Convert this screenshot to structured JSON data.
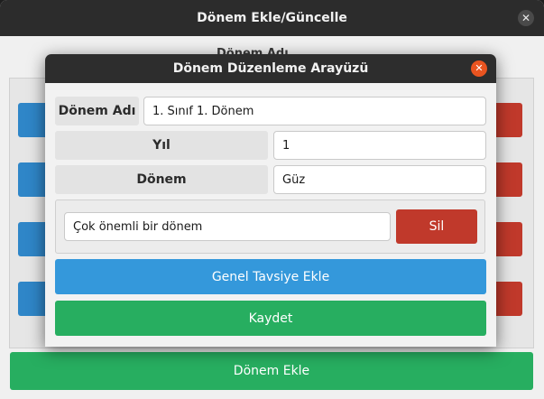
{
  "outer_window": {
    "title": "Dönem Ekle/Güncelle",
    "partial_heading": "Dönem Adı",
    "close_glyph": "✕",
    "add_term_label": "Dönem Ekle"
  },
  "dialog": {
    "title": "Dönem Düzenleme Arayüzü",
    "close_glyph": "✕",
    "fields": {
      "term_name_label": "Dönem Adı",
      "term_name_value": "1. Sınıf 1. Dönem",
      "year_label": "Yıl",
      "year_value": "1",
      "semester_label": "Dönem",
      "semester_value": "Güz"
    },
    "note": {
      "value": "Çok önemli bir dönem",
      "delete_label": "Sil"
    },
    "add_general_advice_label": "Genel Tavsiye Ekle",
    "save_label": "Kaydet"
  },
  "colors": {
    "accent_blue": "#3498db",
    "danger_red": "#c0392b",
    "success_green": "#27ae60",
    "close_orange": "#e95420",
    "titlebar_dark": "#2d2d2d"
  }
}
